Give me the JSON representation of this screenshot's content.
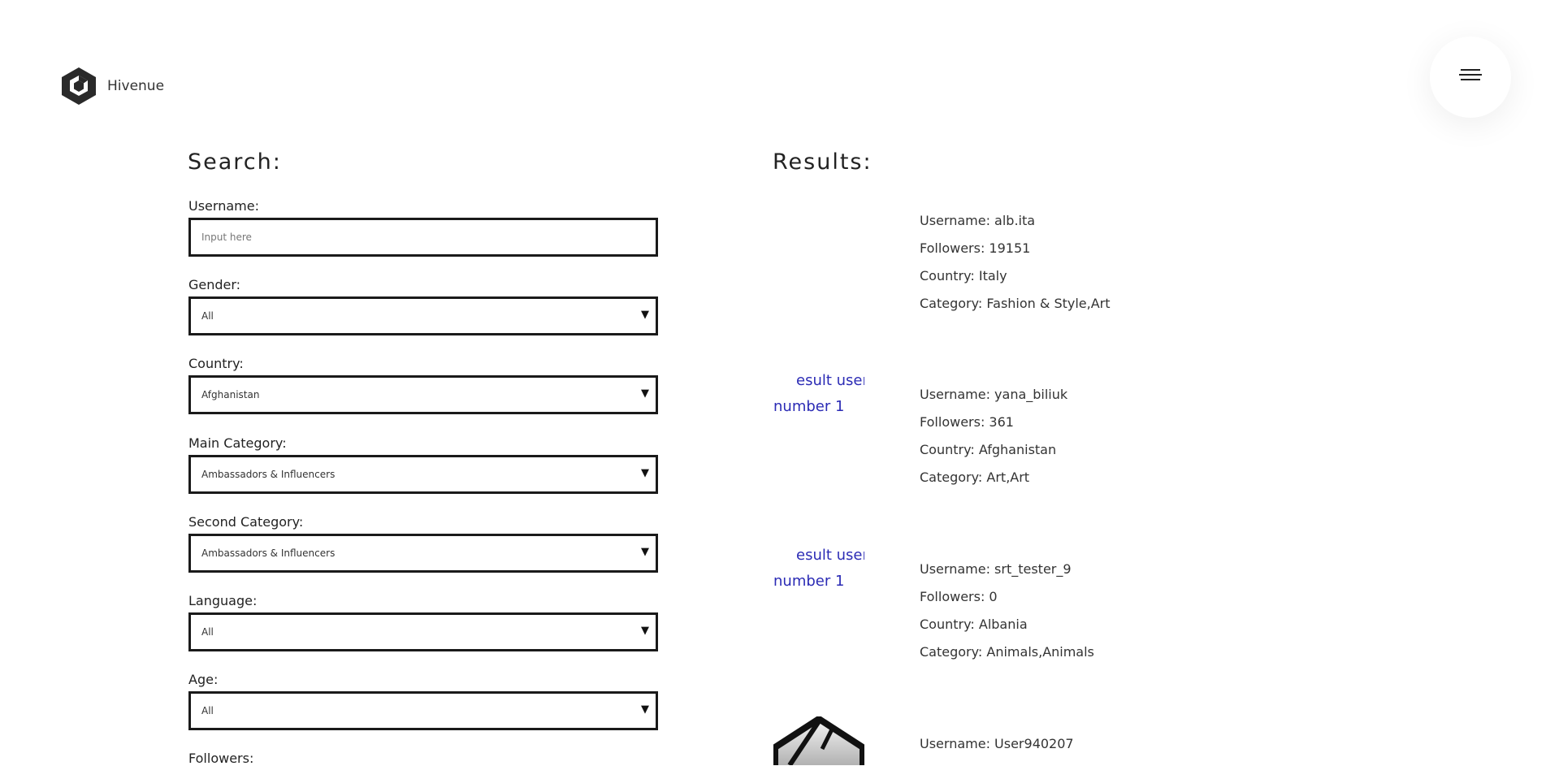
{
  "brand": {
    "name": "Hivenue",
    "logo_icon": "hexagon-cube-logo"
  },
  "menu": {
    "icon": "hamburger-menu-icon"
  },
  "search": {
    "heading": "Search:",
    "username": {
      "label": "Username:",
      "placeholder": "Input here",
      "value": ""
    },
    "gender": {
      "label": "Gender:",
      "value": "All"
    },
    "country": {
      "label": "Country:",
      "value": "Afghanistan"
    },
    "main_category": {
      "label": "Main Category:",
      "value": "Ambassadors & Influencers"
    },
    "second_category": {
      "label": "Second Category:",
      "value": "Ambassadors & Influencers"
    },
    "language": {
      "label": "Language:",
      "value": "All"
    },
    "age": {
      "label": "Age:",
      "value": "All"
    },
    "followers": {
      "label": "Followers:"
    }
  },
  "results": {
    "heading": "Results:",
    "items": [
      {
        "username": "Username: alb.ita",
        "followers": "Followers: 19151",
        "country": "Country: Italy",
        "category": "Category: Fashion & Style,Art",
        "img_alt": ""
      },
      {
        "username": "Username: yana_biliuk",
        "followers": "Followers: 361",
        "country": "Country: Afghanistan",
        "category": "Category: Art,Art",
        "img_alt_line1": "esult user",
        "img_alt_line2": "number 1"
      },
      {
        "username": "Username: srt_tester_9",
        "followers": "Followers: 0",
        "country": "Country: Albania",
        "category": "Category: Animals,Animals",
        "img_alt_line1": "esult user",
        "img_alt_line2": "number 1"
      },
      {
        "username": "Username: User940207"
      }
    ]
  }
}
